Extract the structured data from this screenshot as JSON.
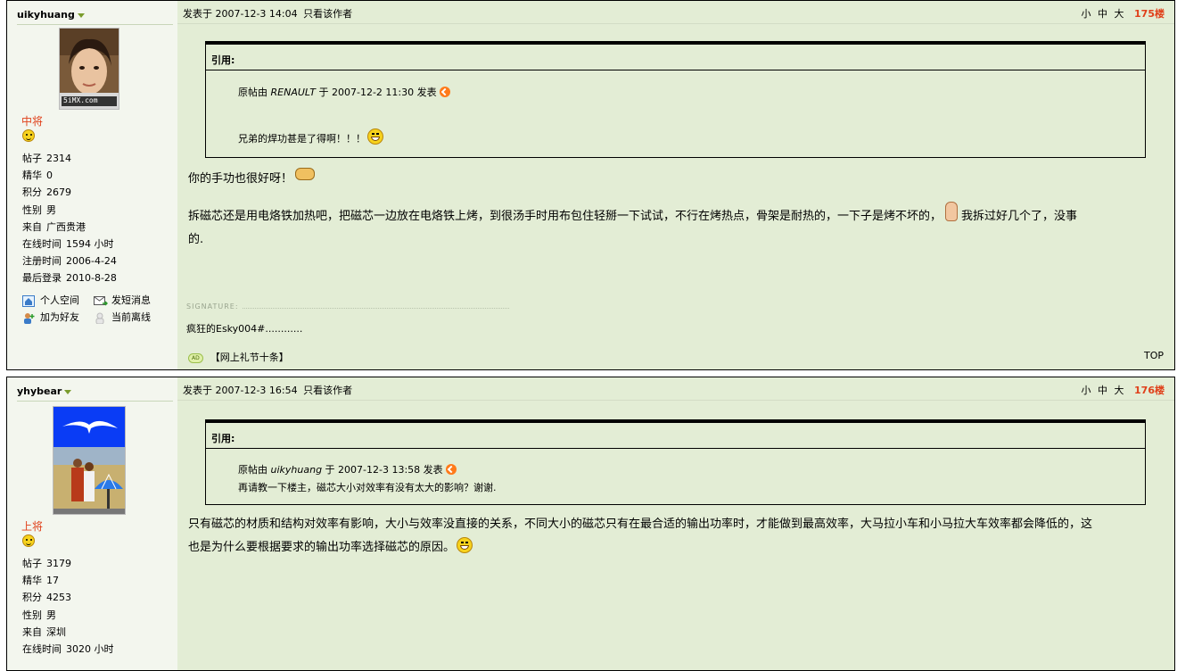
{
  "posts": [
    {
      "username": "uikyhuang",
      "rank": "中将",
      "stats": [
        {
          "k": "帖子",
          "v": "2314"
        },
        {
          "k": "精华",
          "v": "0"
        },
        {
          "k": "积分",
          "v": "2679"
        },
        {
          "k": "性别",
          "v": "男"
        },
        {
          "k": "来自",
          "v": "广西贵港"
        },
        {
          "k": "在线时间",
          "v": "1594 小时"
        },
        {
          "k": "注册时间",
          "v": "2006-4-24"
        },
        {
          "k": "最后登录",
          "v": "2010-8-28"
        }
      ],
      "links": {
        "space": "个人空间",
        "pm": "发短消息",
        "friend": "加为好友",
        "status": "当前离线"
      },
      "avatar_watermark": "5iMX.com",
      "posted": "发表于 2007-12-3 14:04",
      "only_author": "只看该作者",
      "size_small": "小",
      "size_mid": "中",
      "size_large": "大",
      "floor": "175楼",
      "quote_label": "引用:",
      "quote_src_prefix": "原帖由",
      "quote_author": "RENAULT",
      "quote_src_suffix": "于 2007-12-2 11:30 发表",
      "quote_text": "兄弟的焊功甚是了得啊！！！",
      "body_p1": "你的手功也很好呀！",
      "body_p2a": "拆磁芯还是用电烙铁加热吧，把磁芯一边放在电烙铁上烤，到很汤手时用布包住轻掰一下试试，不行在烤热点，骨架是耐热的，一下子是烤不坏的，",
      "body_p2b": "我拆过好几个了，没事",
      "body_p2c": "的.",
      "sig_label": "SIGNATURE:",
      "signature": "疯狂的Esky004#............",
      "ad_badge": "AD",
      "ad_text": "【网上礼节十条】",
      "top": "TOP"
    },
    {
      "username": "yhybear",
      "rank": "上将",
      "stats": [
        {
          "k": "帖子",
          "v": "3179"
        },
        {
          "k": "精华",
          "v": "17"
        },
        {
          "k": "积分",
          "v": "4253"
        },
        {
          "k": "性别",
          "v": "男"
        },
        {
          "k": "来自",
          "v": "深圳"
        },
        {
          "k": "在线时间",
          "v": "3020 小时"
        }
      ],
      "posted": "发表于 2007-12-3 16:54",
      "only_author": "只看该作者",
      "size_small": "小",
      "size_mid": "中",
      "size_large": "大",
      "floor": "176楼",
      "quote_label": "引用:",
      "quote_src_prefix": "原帖由",
      "quote_author": "uikyhuang",
      "quote_src_suffix": "于 2007-12-3 13:58 发表",
      "quote_text": "再请教一下楼主，磁芯大小对效率有没有太大的影响？谢谢.",
      "body_p1": "只有磁芯的材质和结构对效率有影响，大小与效率没直接的关系，不同大小的磁芯只有在最合适的输出功率时，才能做到最高效率，大马拉小车和小马拉大车效率都会降低的，这",
      "body_p2": "也是为什么要根据要求的输出功率选择磁芯的原因。"
    }
  ],
  "colors": {
    "post_bg": "#e3edd5",
    "side_bg": "#f3f6ee",
    "accent": "#e0401a"
  }
}
